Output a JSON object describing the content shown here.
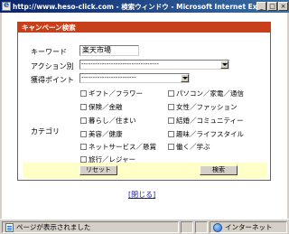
{
  "window": {
    "title": "http://www.heso-click.com - 検索ウィンドウ - Microsoft Internet Explorer",
    "min_btn": "_",
    "max_btn": "□",
    "close_btn": "×"
  },
  "panel": {
    "header": "キャンペーン検索"
  },
  "form": {
    "keyword_label": "キーワード",
    "keyword_value": "楽天市場",
    "action_label": "アクション別",
    "action_value": "----------------------------------",
    "point_label": "獲得ポイント",
    "point_value": "------------------------",
    "category_label": "カテゴリ",
    "categories": [
      "ギフト／フラワー",
      "パソコン／家電／通信",
      "保険／金融",
      "女性／ファッション",
      "暮らし／住まい",
      "結婚／コミュニティー",
      "美容／健康",
      "趣味／ライフスタイル",
      "ネットサービス／懸賞",
      "働く／学ぶ",
      "旅行／レジャー"
    ],
    "reset_label": "リセット",
    "search_label": "検索"
  },
  "close_link": "[閉じる]",
  "status": {
    "message": "ページが表示されました",
    "zone": "インターネット"
  }
}
